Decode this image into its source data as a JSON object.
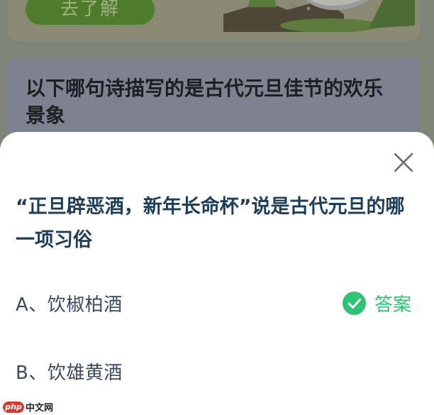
{
  "background": {
    "banner_button_label": "去了解",
    "question": "以下哪句诗描写的是古代元旦佳节的欢乐景象"
  },
  "sheet": {
    "question": "“正旦辟恶酒，新年长命杯”说是古代元旦的哪一项习俗",
    "options": [
      {
        "label": "A、饮椒柏酒",
        "is_answer": true
      },
      {
        "label": "B、饮雄黄酒",
        "is_answer": false
      }
    ],
    "answer_label": "答案",
    "icons": {
      "close": "close-icon",
      "check": "check-circle-icon"
    }
  },
  "watermark": {
    "logo_text": "php",
    "site_text": "中文网"
  },
  "colors": {
    "accent_green": "#2fc275",
    "question_text": "#1e3d58",
    "option_text": "#3b4b5e",
    "overlay": "#7f8479"
  }
}
